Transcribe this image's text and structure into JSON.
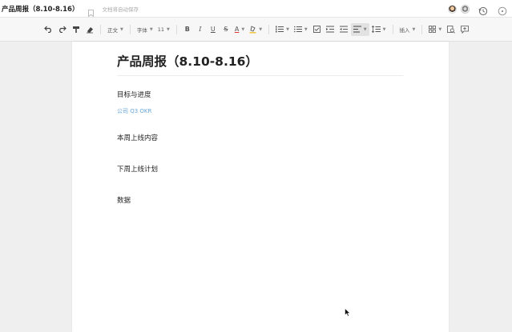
{
  "titlebar": {
    "doc_title": "产品周报（8.10-8.16）",
    "autosave_text": "文档将自动保存",
    "icons": [
      "bookmark-icon",
      "history-icon",
      "more-icon"
    ]
  },
  "toolbar": {
    "style_label": "正文",
    "font_label": "字体",
    "size_label": "11",
    "bold_label": "B",
    "italic_label": "I",
    "underline_label": "U",
    "strike_label": "S",
    "color_label": "A",
    "insert_label": "插入"
  },
  "document": {
    "title": "产品周报（8.10-8.16）",
    "sections": [
      {
        "heading": "目标与进度",
        "link": "公司 Q3 OKR"
      },
      {
        "heading": "本周上线内容"
      },
      {
        "heading": "下周上线计划"
      },
      {
        "heading": "数据"
      }
    ]
  },
  "colors": {
    "link": "#6aa6d6",
    "text": "#222222",
    "toolbar_bg": "#f7f7f7"
  }
}
